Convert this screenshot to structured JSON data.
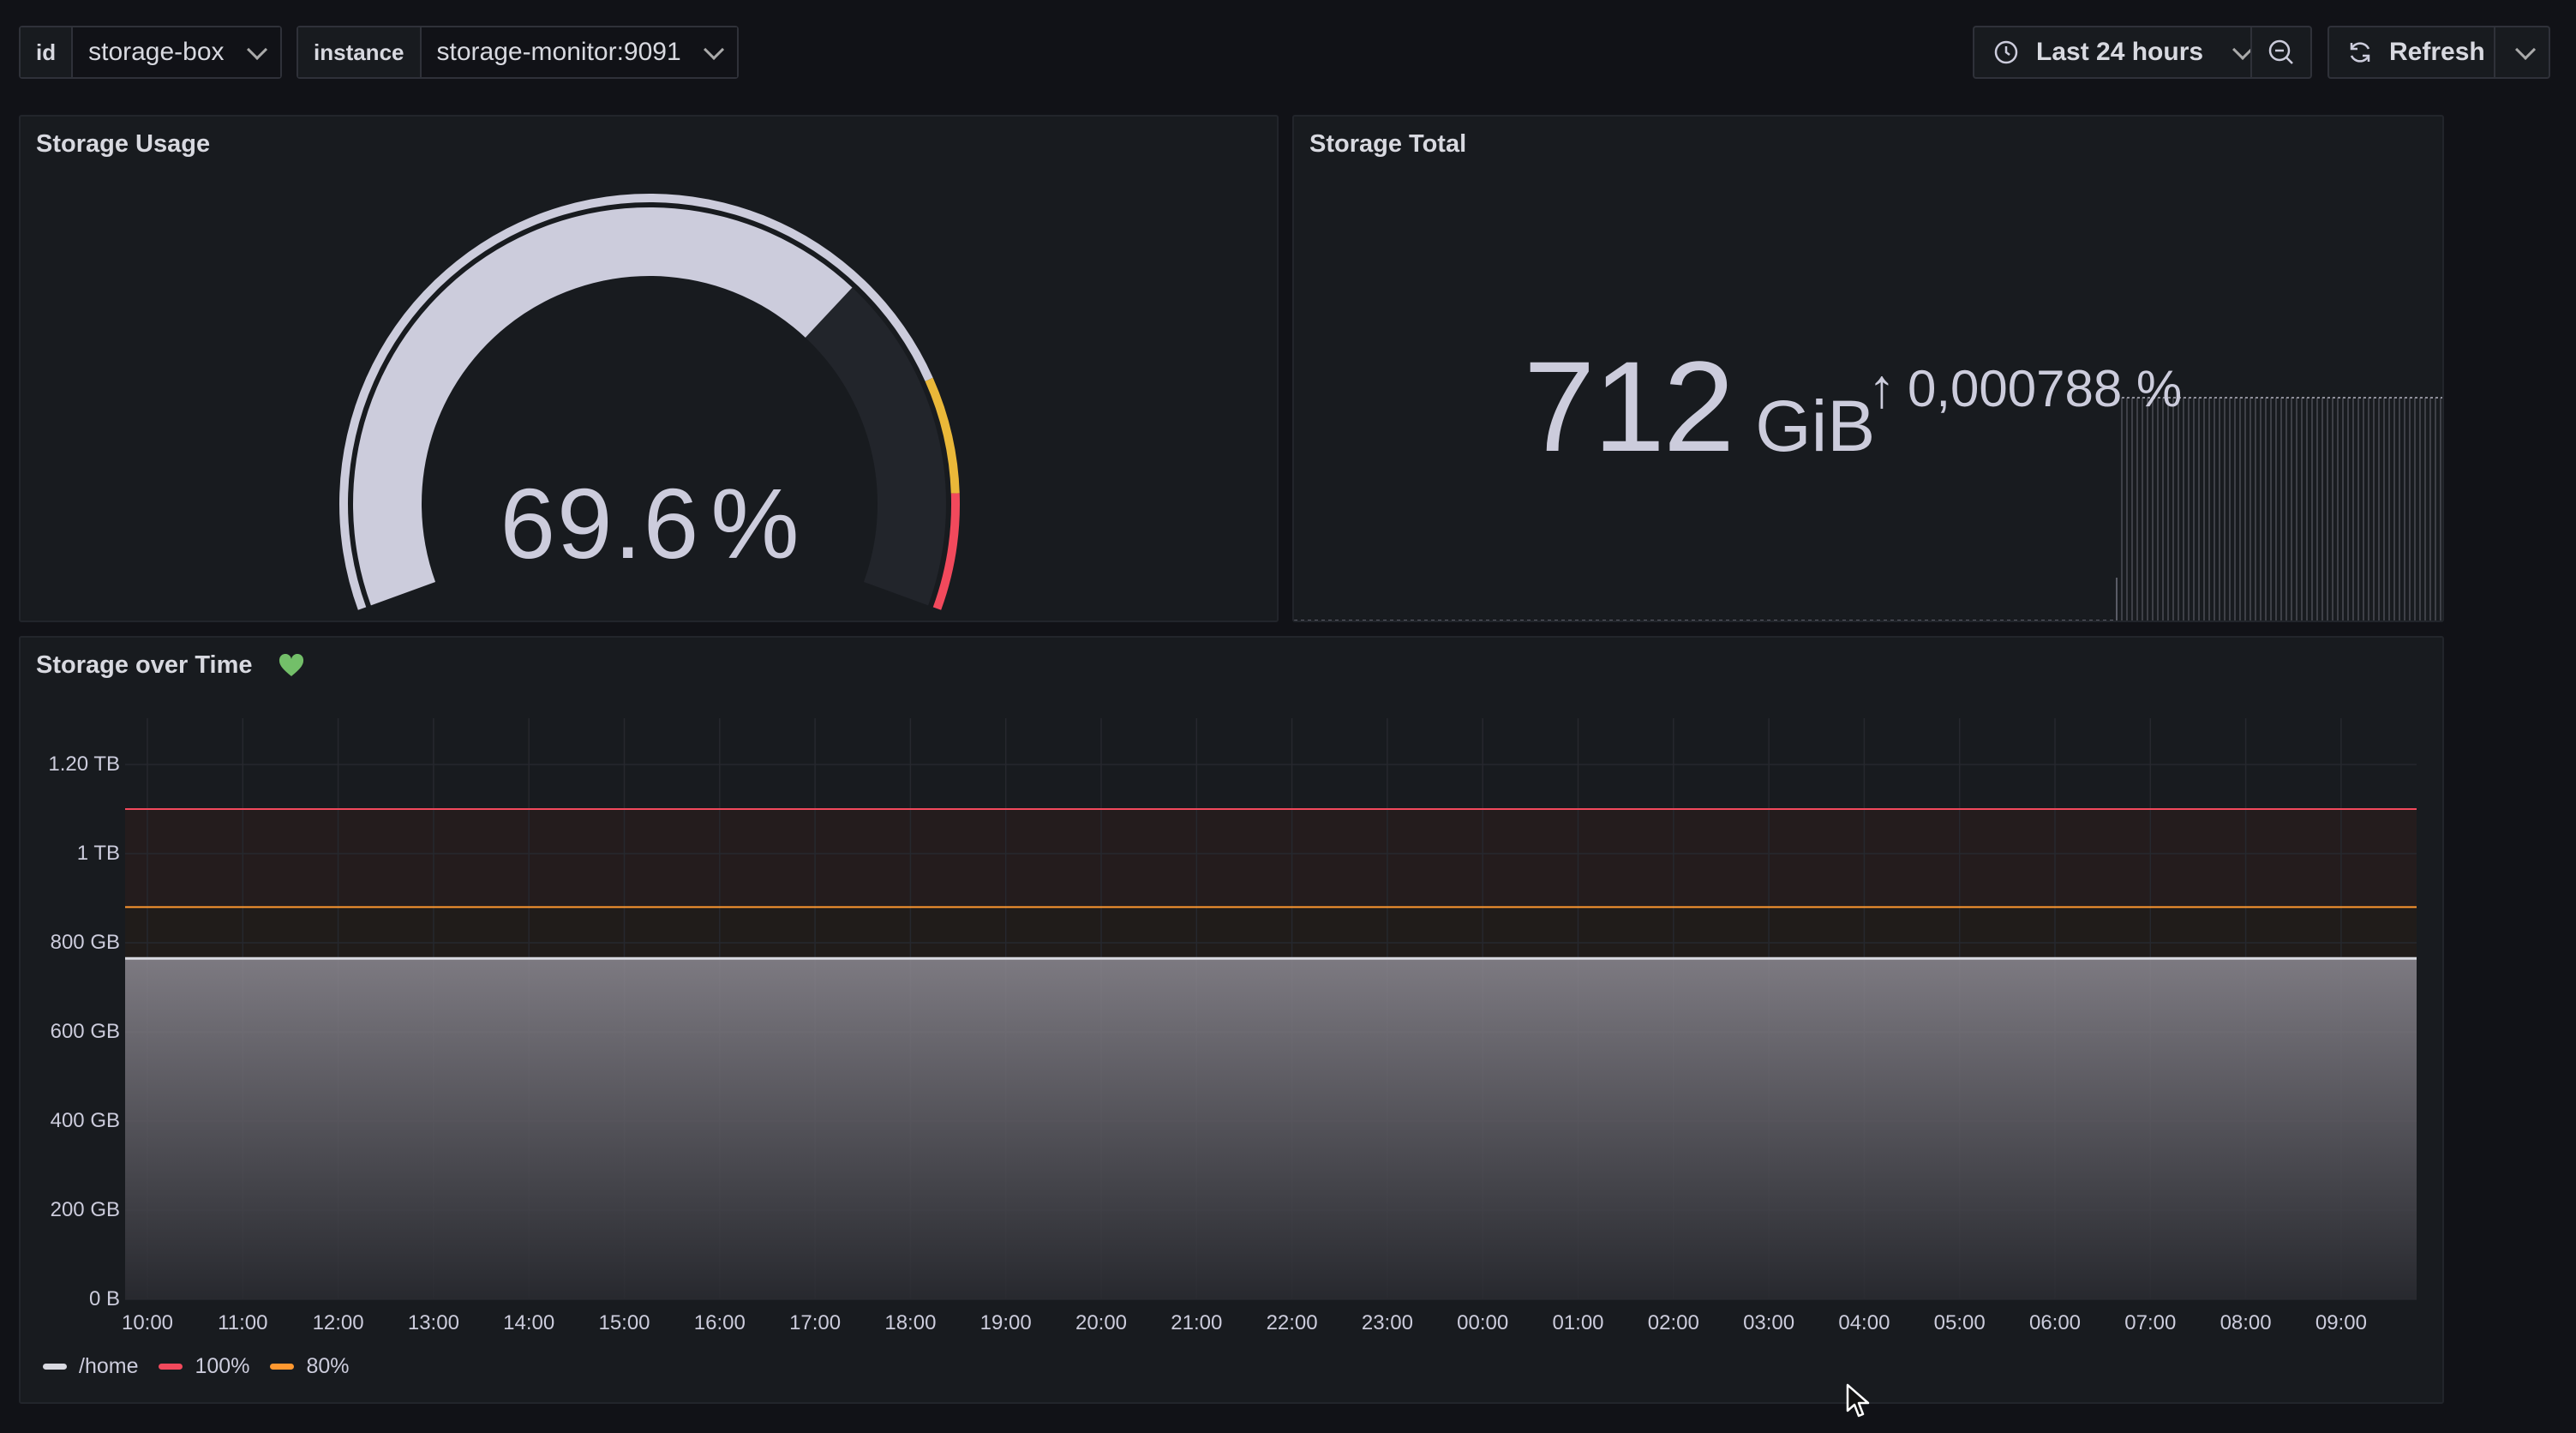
{
  "toolbar": {
    "var1": {
      "label": "id",
      "value": "storage-box"
    },
    "var2": {
      "label": "instance",
      "value": "storage-monitor:9091"
    },
    "time_range": "Last 24 hours",
    "refresh_label": "Refresh"
  },
  "gauge_panel": {
    "title": "Storage Usage",
    "value": "69.6",
    "unit": "%",
    "fraction": 0.696,
    "thresholds": {
      "yellow_start": 0.8,
      "red_start": 0.9
    },
    "colors": {
      "value": "#ccccdc",
      "track": "#22252b",
      "yellow": "#eab839",
      "red": "#f2495c"
    }
  },
  "stat_panel": {
    "title": "Storage Total",
    "value": "712",
    "unit": "GiB",
    "change": "0,000788 %",
    "arrow": "↑"
  },
  "timeseries_panel": {
    "title": "Storage over Time",
    "status_icon": "heart-icon",
    "status_color": "#73bf69"
  },
  "chart_data": {
    "type": "area",
    "x": [
      "10:00",
      "11:00",
      "12:00",
      "13:00",
      "14:00",
      "15:00",
      "16:00",
      "17:00",
      "18:00",
      "19:00",
      "20:00",
      "21:00",
      "22:00",
      "23:00",
      "00:00",
      "01:00",
      "02:00",
      "03:00",
      "04:00",
      "05:00",
      "06:00",
      "07:00",
      "08:00",
      "09:00"
    ],
    "ytick_labels": [
      "1.20 TB",
      "1 TB",
      "800 GB",
      "600 GB",
      "400 GB",
      "200 GB",
      "0 B"
    ],
    "ylim_gb": [
      0,
      1200
    ],
    "series": [
      {
        "name": "/home",
        "value_gb": 765,
        "color": "#d8d9e0"
      },
      {
        "name": "100%",
        "value_gb": 1100,
        "color": "#f2495c"
      },
      {
        "name": "80%",
        "value_gb": 880,
        "color": "#ff9830"
      }
    ],
    "grid": true,
    "legend": "bottom-left"
  }
}
